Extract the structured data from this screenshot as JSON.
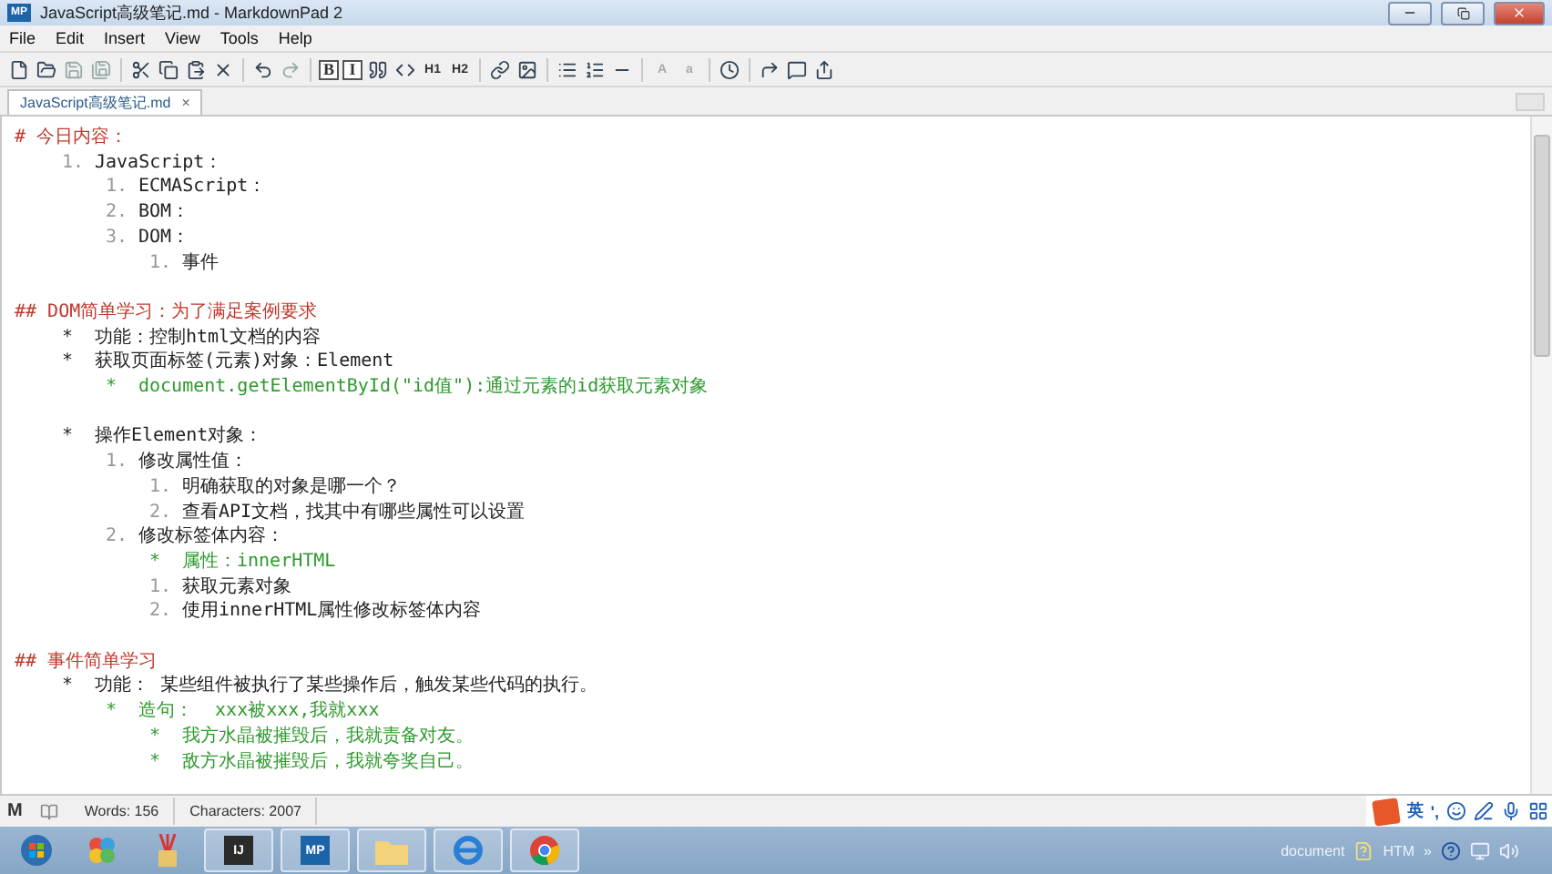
{
  "window": {
    "app_badge": "MP",
    "title": "JavaScript高级笔记.md - MarkdownPad 2"
  },
  "menu": [
    "File",
    "Edit",
    "Insert",
    "View",
    "Tools",
    "Help"
  ],
  "toolbar": [
    {
      "kind": "new"
    },
    {
      "kind": "open"
    },
    {
      "kind": "save"
    },
    {
      "kind": "saveall"
    },
    {
      "kind": "separator"
    },
    {
      "kind": "cut"
    },
    {
      "kind": "copy"
    },
    {
      "kind": "paste"
    },
    {
      "kind": "delete"
    },
    {
      "kind": "separator"
    },
    {
      "kind": "undo"
    },
    {
      "kind": "redo"
    },
    {
      "kind": "separator"
    },
    {
      "kind": "boxed",
      "label": "B"
    },
    {
      "kind": "boxed",
      "label": "I"
    },
    {
      "kind": "quote"
    },
    {
      "kind": "code"
    },
    {
      "kind": "text",
      "label": "H1"
    },
    {
      "kind": "text",
      "label": "H2"
    },
    {
      "kind": "separator"
    },
    {
      "kind": "link"
    },
    {
      "kind": "image"
    },
    {
      "kind": "separator"
    },
    {
      "kind": "bullets"
    },
    {
      "kind": "numbers"
    },
    {
      "kind": "rule"
    },
    {
      "kind": "separator"
    },
    {
      "kind": "faint",
      "label": "A"
    },
    {
      "kind": "faint",
      "label": "a"
    },
    {
      "kind": "separator"
    },
    {
      "kind": "clock"
    },
    {
      "kind": "separator"
    },
    {
      "kind": "swap"
    },
    {
      "kind": "preview"
    },
    {
      "kind": "export"
    }
  ],
  "tabs": [
    {
      "label": "JavaScript高级笔记.md",
      "close": "×",
      "selected": true
    }
  ],
  "editor": {
    "sections": [
      {
        "heading": "# 今日内容：",
        "items": [
          {
            "marker": "1.",
            "text": "JavaScript：",
            "kind": "plain",
            "children": [
              {
                "marker": "1.",
                "text": "ECMAScript：",
                "kind": "plain"
              },
              {
                "marker": "2.",
                "text": "BOM：",
                "kind": "plain"
              },
              {
                "marker": "3.",
                "text": "DOM：",
                "kind": "plain",
                "children": [
                  {
                    "marker": "1.",
                    "text": "事件",
                    "kind": "plain"
                  }
                ]
              }
            ]
          }
        ]
      },
      {
        "heading": "## DOM简单学习：为了满足案例要求",
        "items": [
          {
            "marker": "*",
            "text": "功能：控制html文档的内容",
            "kind": "plain"
          },
          {
            "marker": "*",
            "text": "获取页面标签(元素)对象：Element",
            "kind": "plain",
            "children": [
              {
                "marker": "*",
                "text": "document.getElementById(\"id值\"):通过元素的id获取元素对象",
                "kind": "code"
              }
            ]
          },
          {
            "marker": "*",
            "text": "操作Element对象：",
            "kind": "plain",
            "blank_before": true,
            "children": [
              {
                "marker": "1.",
                "text": "修改属性值：",
                "kind": "plain",
                "children": [
                  {
                    "marker": "1.",
                    "text": "明确获取的对象是哪一个？",
                    "kind": "plain"
                  },
                  {
                    "marker": "2.",
                    "text": "查看API文档，找其中有哪些属性可以设置",
                    "kind": "plain"
                  }
                ]
              },
              {
                "marker": "2.",
                "text": "修改标签体内容：",
                "kind": "plain",
                "children": [
                  {
                    "marker": "*",
                    "text": "属性：innerHTML",
                    "kind": "code"
                  },
                  {
                    "marker": "1.",
                    "text": "获取元素对象",
                    "kind": "plain"
                  },
                  {
                    "marker": "2.",
                    "text": "使用innerHTML属性修改标签体内容",
                    "kind": "plain"
                  }
                ]
              }
            ]
          }
        ]
      },
      {
        "heading": "## 事件简单学习",
        "items": [
          {
            "marker": "*",
            "text": "功能： 某些组件被执行了某些操作后，触发某些代码的执行。",
            "kind": "plain",
            "children": [
              {
                "marker": "*",
                "text": "造句：  xxx被xxx,我就xxx",
                "kind": "code",
                "children": [
                  {
                    "marker": "*",
                    "text": "我方水晶被摧毁后，我就责备对友。",
                    "kind": "code"
                  },
                  {
                    "marker": "*",
                    "text": "敌方水晶被摧毁后，我就夸奖自己。",
                    "kind": "code"
                  }
                ]
              }
            ]
          }
        ]
      }
    ]
  },
  "status_bar": {
    "mode_glyph": "M",
    "words": "Words: 156",
    "characters": "Characters: 2007"
  },
  "ime_bar": {
    "mode": "英",
    "punctuation": "',"
  },
  "taskbar": {
    "apps": [
      {
        "kind": "start",
        "open": false
      },
      {
        "kind": "tiles",
        "open": false
      },
      {
        "kind": "brushes",
        "open": false
      },
      {
        "kind": "ide",
        "label": "IJ",
        "open": true
      },
      {
        "kind": "editor",
        "label": "MP",
        "open": true
      },
      {
        "kind": "folder",
        "open": true
      },
      {
        "kind": "ie",
        "open": true
      },
      {
        "kind": "chrome",
        "open": true
      }
    ],
    "tray": {
      "label": "document",
      "file_type": "HTM",
      "more": "»"
    }
  }
}
